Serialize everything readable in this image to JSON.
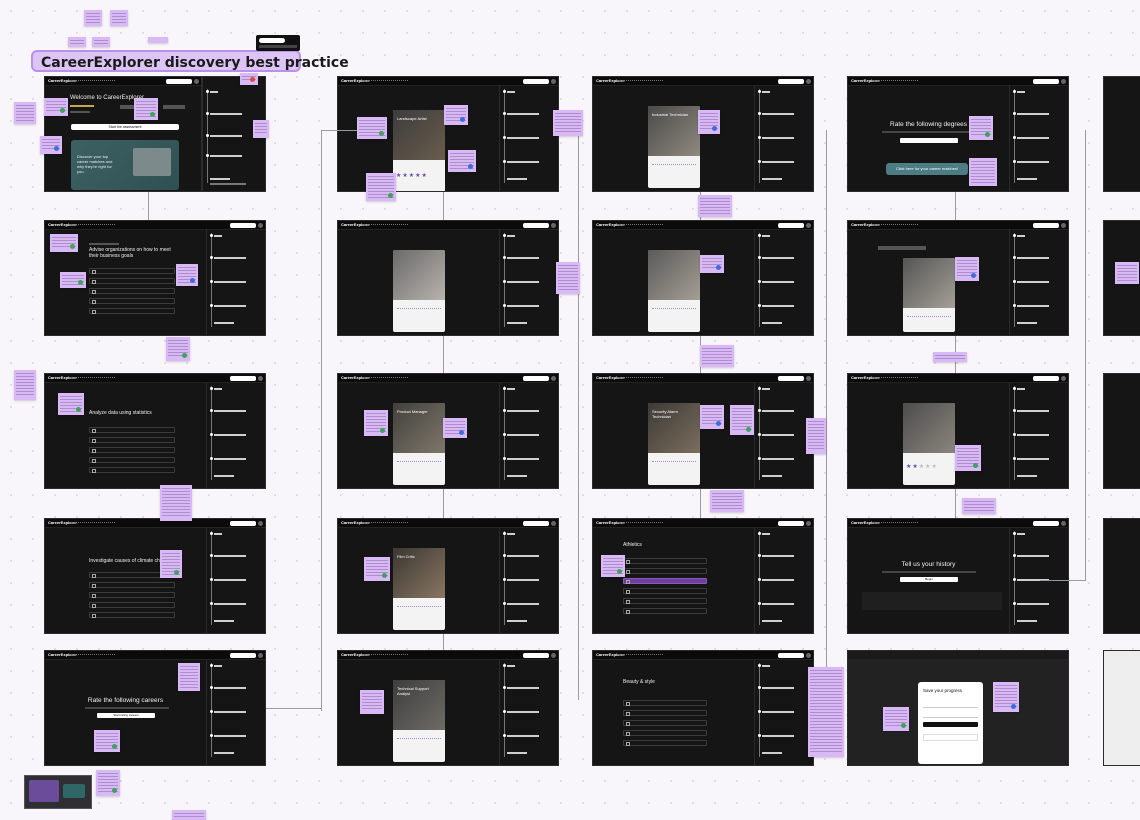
{
  "board": {
    "title": "CareerExplorer discovery best practice"
  },
  "colors": {
    "background": "#f8f5fb",
    "frame_bg": "#151515",
    "sticky_note": "#d8b9f5",
    "accent_purple": "#6e3f9a",
    "title_banner": "#dcc5f5"
  },
  "frames": [
    {
      "column": 1,
      "screen": "welcome",
      "heading": "Welcome to CareerExplorer",
      "button": "Start the assessment",
      "promo": "Discover your top career matches and why they're right for you."
    },
    {
      "column": 1,
      "screen": "question",
      "heading": "Advise organizations on how to meet their business goals"
    },
    {
      "column": 1,
      "screen": "question",
      "heading": "Analyze data using statistics"
    },
    {
      "column": 1,
      "screen": "question",
      "heading": "Investigate causes of climate change"
    },
    {
      "column": 1,
      "screen": "rate-careers",
      "heading": "Rate the following careers",
      "button": "Start rating careers"
    },
    {
      "column": 2,
      "screen": "career-card",
      "card_title": "Landscape Artist"
    },
    {
      "column": 2,
      "screen": "career-card",
      "card_title": ""
    },
    {
      "column": 2,
      "screen": "career-card",
      "card_title": "Product Manager"
    },
    {
      "column": 2,
      "screen": "career-card",
      "card_title": "Film Critic"
    },
    {
      "column": 2,
      "screen": "career-card",
      "card_title": "Technical Support Analyst"
    },
    {
      "column": 3,
      "screen": "career-card",
      "card_title": "Industrial Technician"
    },
    {
      "column": 3,
      "screen": "career-card",
      "card_title": ""
    },
    {
      "column": 3,
      "screen": "career-card",
      "card_title": "Security Alarm Technician"
    },
    {
      "column": 3,
      "screen": "question",
      "heading": "Athletics"
    },
    {
      "column": 3,
      "screen": "question",
      "heading": "Beauty & style"
    },
    {
      "column": 4,
      "screen": "rate-degrees",
      "heading": "Rate the following degrees",
      "button": "Click here for your career matches!"
    },
    {
      "column": 4,
      "screen": "degree-card",
      "card_title": ""
    },
    {
      "column": 4,
      "screen": "degree-card",
      "card_title": ""
    },
    {
      "column": 4,
      "screen": "history",
      "heading": "Tell us your history",
      "button": "Begin"
    },
    {
      "column": 4,
      "screen": "save-progress",
      "heading": "Save your progress",
      "button": "Get started"
    }
  ]
}
